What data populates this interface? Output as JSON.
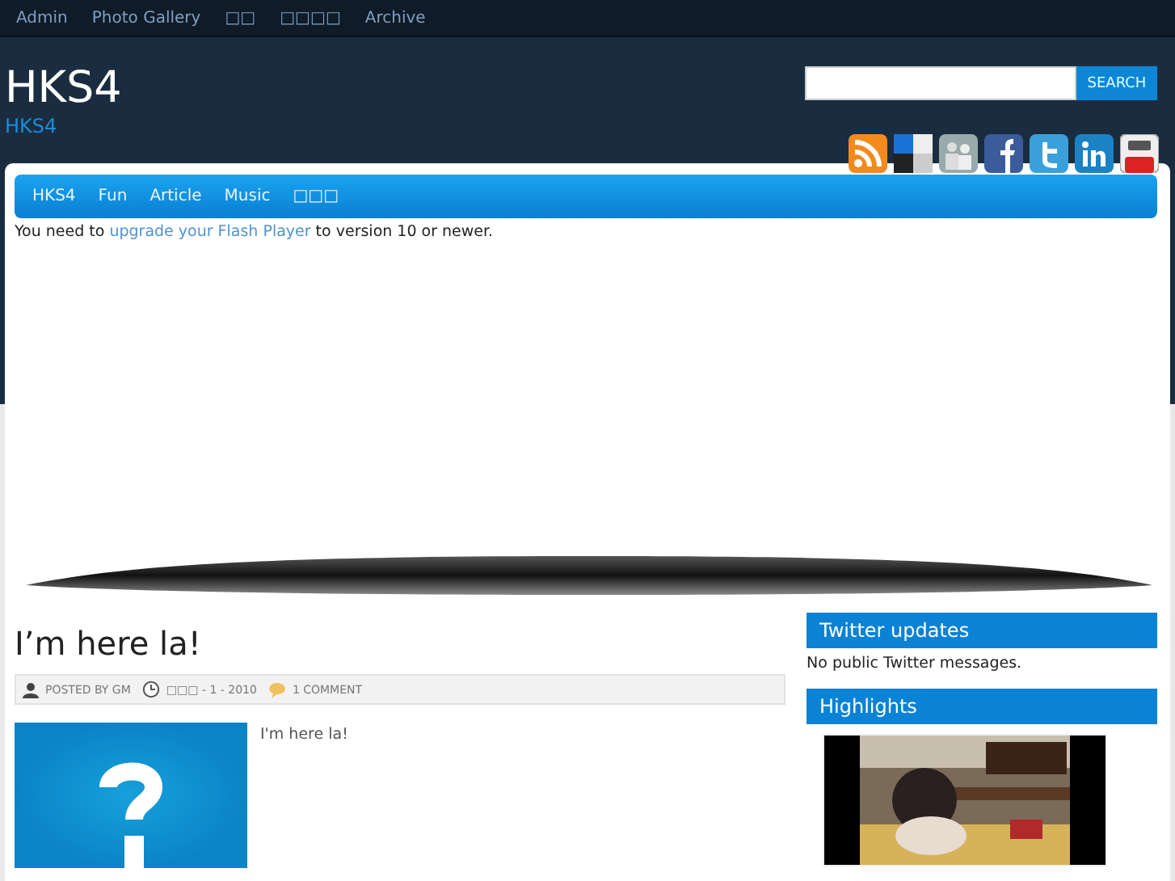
{
  "top_menu": [
    {
      "label": "Admin"
    },
    {
      "label": "Photo Gallery"
    },
    {
      "label": "□□"
    },
    {
      "label": "□□□□"
    },
    {
      "label": "Archive"
    }
  ],
  "site": {
    "title": "HKS4",
    "tagline": "HKS4"
  },
  "search": {
    "button": "SEARCH"
  },
  "social_icons": [
    {
      "kind": "rss"
    },
    {
      "kind": "delicious"
    },
    {
      "kind": "people"
    },
    {
      "kind": "facebook"
    },
    {
      "kind": "twitter"
    },
    {
      "kind": "linkedin"
    },
    {
      "kind": "youtube"
    }
  ],
  "nav": [
    {
      "label": "HKS4"
    },
    {
      "label": "Fun"
    },
    {
      "label": "Article"
    },
    {
      "label": "Music"
    },
    {
      "label": "□□□"
    }
  ],
  "flash_notice": {
    "before": "You need to ",
    "link": "upgrade your Flash Player",
    "after": " to version 10 or newer."
  },
  "post": {
    "title": "I’m here la!",
    "author": "POSTED BY GM",
    "date": "□□□ - 1 - 2010",
    "comments": "1 COMMENT",
    "body": "I'm here la!"
  },
  "sidebar": [
    {
      "kind": "text",
      "title": "Twitter updates",
      "text": "No public Twitter messages."
    },
    {
      "kind": "video",
      "title": "Highlights"
    }
  ]
}
